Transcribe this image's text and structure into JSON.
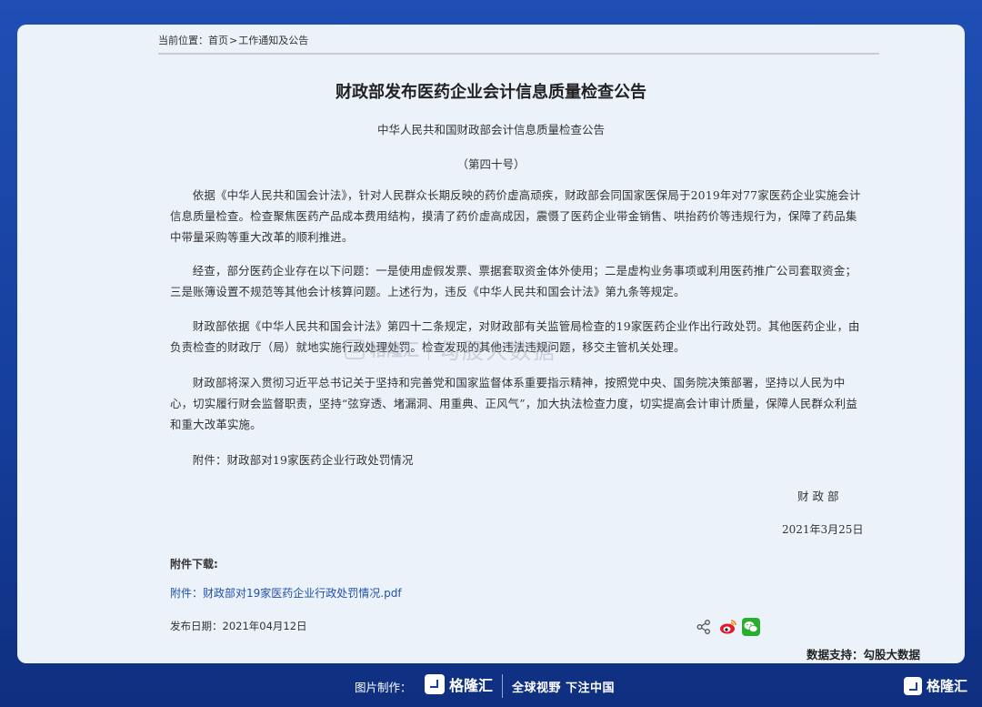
{
  "breadcrumb": {
    "label": "当前位置：",
    "home": "首页",
    "separator": ">",
    "section": "工作通知及公告"
  },
  "article": {
    "title": "财政部发布医药企业会计信息质量检查公告",
    "subtitle": "中华人民共和国财政部会计信息质量检查公告",
    "doc_number": "（第四十号）",
    "paragraphs": [
      "依据《中华人民共和国会计法》，针对人民群众长期反映的药价虚高顽疾，财政部会同国家医保局于2019年对77家医药企业实施会计信息质量检查。检查聚焦医药产品成本费用结构，摸清了药价虚高成因，震慑了医药企业带金销售、哄抬药价等违规行为，保障了药品集中带量采购等重大改革的顺利推进。",
      "经查，部分医药企业存在以下问题：一是使用虚假发票、票据套取资金体外使用；二是虚构业务事项或利用医药推广公司套取资金；三是账簿设置不规范等其他会计核算问题。上述行为，违反《中华人民共和国会计法》第九条等规定。",
      "财政部依据《中华人民共和国会计法》第四十二条规定，对财政部有关监管局检查的19家医药企业作出行政处罚。其他医药企业，由负责检查的财政厅（局）就地实施行政处理处罚。检查发现的其他违法违规问题，移交主管机关处理。",
      "财政部将深入贯彻习近平总书记关于坚持和完善党和国家监督体系重要指示精神，按照党中央、国务院决策部署，坚持以人民为中心，切实履行财会监督职责，坚持“弦穿透、堵漏洞、用重典、正风气”，加大执法检查力度，切实提高会计审计质量，保障人民群众利益和重大改革实施。",
      "附件：财政部对19家医药企业行政处罚情况"
    ],
    "signer": "财 政 部",
    "date": "2021年3月25日"
  },
  "attachments": {
    "label": "附件下载:",
    "link_text": "附件：财政部对19家医药企业行政处罚情况.pdf"
  },
  "publish": {
    "label": "发布日期：",
    "date": "2021年04月12日"
  },
  "share_icons": [
    "share-icon",
    "weibo-icon",
    "wechat-icon"
  ],
  "watermark": {
    "brand": "格隆汇",
    "text": "勾股大数据"
  },
  "data_support": "数据支持：勾股大数据",
  "footer": {
    "credit": "图片制作：",
    "brand": "格隆汇",
    "slogan": "全球视野 下注中国"
  },
  "corner_brand": "格隆汇",
  "colors": {
    "background": "#1f4fb4",
    "panel": "#ecf2fa",
    "link": "#1f4faa",
    "wechat": "#2aae30",
    "weibo": "#e6162d"
  }
}
